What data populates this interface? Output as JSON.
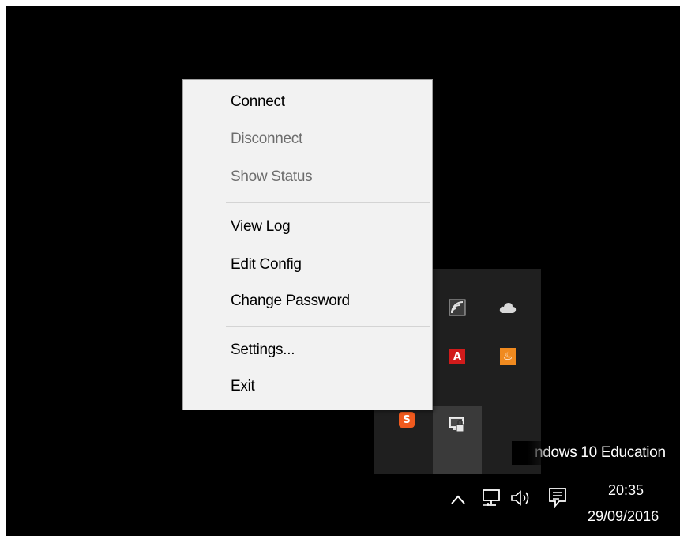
{
  "context_menu": {
    "items": [
      {
        "label": "Connect",
        "enabled": true
      },
      {
        "label": "Disconnect",
        "enabled": false
      },
      {
        "label": "Show Status",
        "enabled": false
      },
      {
        "label": "View Log",
        "enabled": true
      },
      {
        "label": "Edit Config",
        "enabled": true
      },
      {
        "label": "Change Password",
        "enabled": true
      },
      {
        "label": "Settings...",
        "enabled": true
      },
      {
        "label": "Exit",
        "enabled": true
      }
    ]
  },
  "tray_overflow": {
    "icons": [
      {
        "name": "wireless-display-icon"
      },
      {
        "name": "onedrive-cloud-icon"
      },
      {
        "name": "adobe-acrobat-icon",
        "glyph": "A"
      },
      {
        "name": "java-update-icon",
        "glyph": "♨"
      },
      {
        "name": "s-app-icon",
        "glyph": "S"
      },
      {
        "name": "openvpn-icon",
        "selected": true
      }
    ]
  },
  "desktop": {
    "watermark": "ndows 10 Education"
  },
  "taskbar": {
    "show_hidden_icons": "^",
    "clock": {
      "time": "20:35",
      "date": "29/09/2016"
    }
  },
  "colors": {
    "desktop_bg": "#000000",
    "menu_bg": "#f2f2f2",
    "flyout_bg": "#1f1f1f",
    "disabled_text": "#6d6d6d"
  }
}
